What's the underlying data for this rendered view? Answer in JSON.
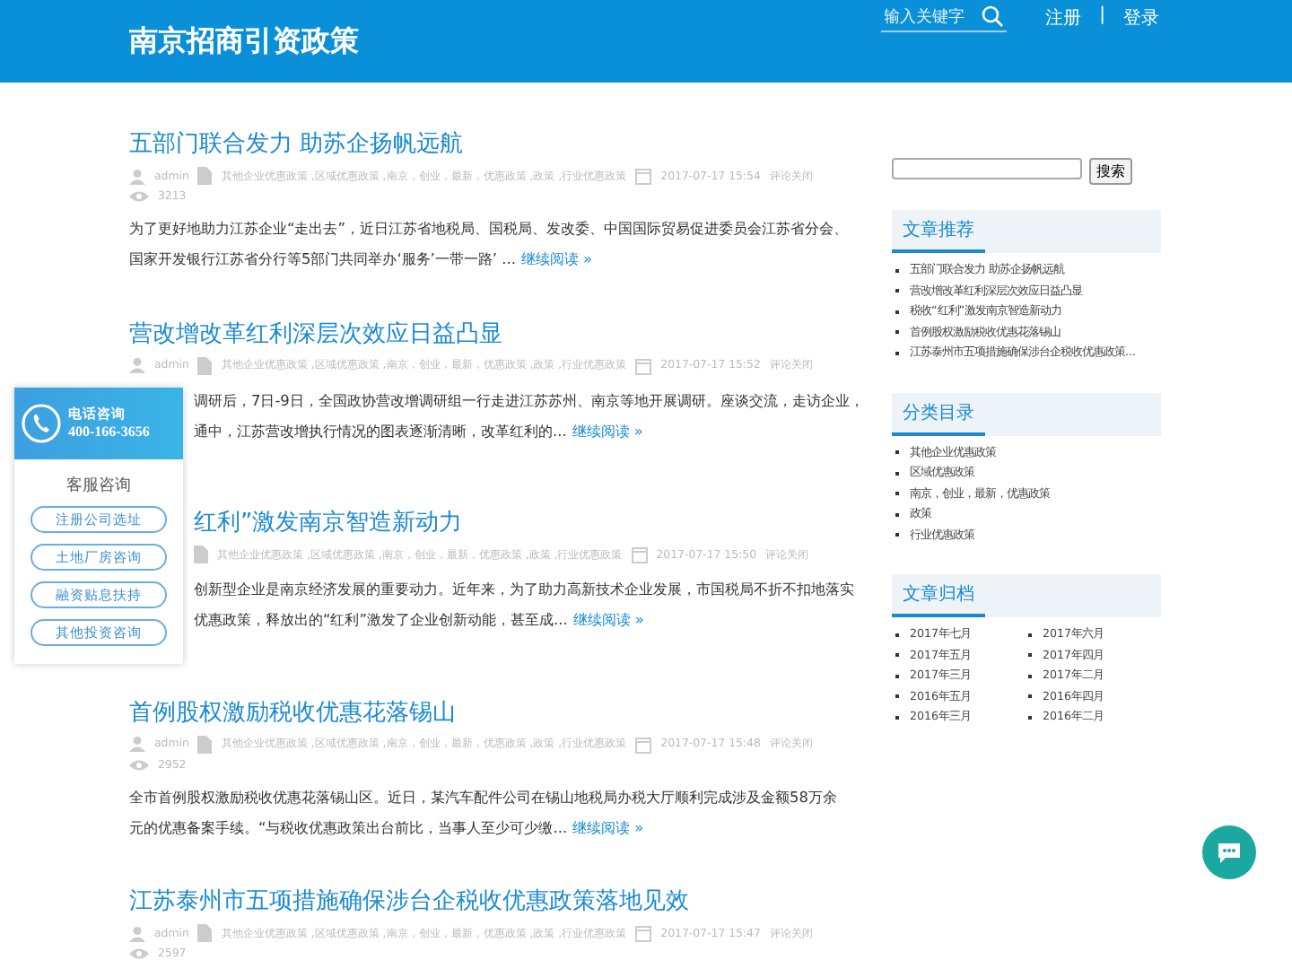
{
  "header": {
    "site_title": "南京招商引资政策",
    "search": {
      "placeholder": "输入关键字"
    },
    "links": [
      "注册",
      "登录"
    ],
    "separator": "|"
  },
  "posts": [
    {
      "title": "五部门联合发力 助苏企扬帆远航",
      "author": "admin",
      "categories": "其他企业优惠政策 ,区域优惠政策 ,南京，创业，最新，优惠政策 ,政策 ,行业优惠政策",
      "date": "2017-07-17 15:54",
      "comments": "评论关闭",
      "views": "3213",
      "excerpt": [
        "为了更好地助力江苏企业“走出去”，近日江苏省地税局、国税局、发改委、中国国际贸易促进委员会江苏省分会、",
        "国家开发银行江苏省分行等5部门共同举办‘服务’一带一路’ ..."
      ],
      "more": "继续阅读 »"
    },
    {
      "title": "营改增改革红利深层次效应日益凸显",
      "author": "admin",
      "categories": "其他企业优惠政策 ,区域优惠政策 ,南京，创业，最新，优惠政策 ,政策 ,行业优惠政策",
      "date": "2017-07-17 15:52",
      "comments": "评论关闭",
      "excerpt": [
        "调研后，7日-9日，全国政协营改增调研组一行走进江苏苏州、南京等地开展调研。座谈交流，走访企业，",
        "通中，江苏营改增执行情况的图表逐渐清晰，改革红利的..."
      ],
      "more": "继续阅读 »"
    },
    {
      "title": "红利”激发南京智造新动力",
      "categories": "其他企业优惠政策 ,区域优惠政策 ,南京，创业，最新，优惠政策 ,政策 ,行业优惠政策",
      "date": "2017-07-17 15:50",
      "comments": "评论关闭",
      "excerpt": [
        "创新型企业是南京经济发展的重要动力。近年来，为了助力高新技术企业发展，市国税局不折不扣地落实",
        "优惠政策，释放出的“红利”激发了企业创新动能，甚至成..."
      ],
      "more": "继续阅读 »"
    },
    {
      "title": "首例股权激励税收优惠花落锡山",
      "author": "admin",
      "categories": "其他企业优惠政策 ,区域优惠政策 ,南京，创业，最新，优惠政策 ,政策 ,行业优惠政策",
      "date": "2017-07-17 15:48",
      "comments": "评论关闭",
      "views": "2952",
      "excerpt": [
        "全市首例股权激励税收优惠花落锡山区。近日，某汽车配件公司在锡山地税局办税大厅顺利完成涉及金额58万余",
        "元的优惠备案手续。“与税收优惠政策出台前比，当事人至少可少缴..."
      ],
      "more": "继续阅读 »"
    },
    {
      "title": "江苏泰州市五项措施确保涉台企税收优惠政策落地见效",
      "author": "admin",
      "categories": "其他企业优惠政策 ,区域优惠政策 ,南京，创业，最新，优惠政策 ,政策 ,行业优惠政策",
      "date": "2017-07-17 15:47",
      "comments": "评论关闭",
      "views": "2597"
    }
  ],
  "sidebar": {
    "search_button": "搜索",
    "sections": [
      {
        "title": "文章推荐",
        "kind": "list",
        "items": [
          "五部门联合发力 助苏企扬帆远航",
          "营改增改革红利深层次效应日益凸显",
          "税收“红利”激发南京智造新动力",
          "首例股权激励税收优惠花落锡山",
          "江苏泰州市五项措施确保涉台企税收优惠政策..."
        ]
      },
      {
        "title": "分类目录",
        "kind": "list",
        "items": [
          "其他企业优惠政策",
          "区域优惠政策",
          "南京，创业，最新，优惠政策",
          "政策",
          "行业优惠政策"
        ]
      },
      {
        "title": "文章归档",
        "kind": "grid",
        "items": [
          "2017年七月",
          "2017年六月",
          "2017年五月",
          "2017年四月",
          "2017年三月",
          "2017年二月",
          "2016年五月",
          "2016年四月",
          "2016年三月",
          "2016年二月"
        ]
      }
    ]
  },
  "float_widget": {
    "phone_label": "电话咨询",
    "phone": "400-166-3656",
    "heading": "客服咨询",
    "buttons": [
      "注册公司选址",
      "土地厂房咨询",
      "融资贴息扶持",
      "其他投资咨询"
    ]
  }
}
